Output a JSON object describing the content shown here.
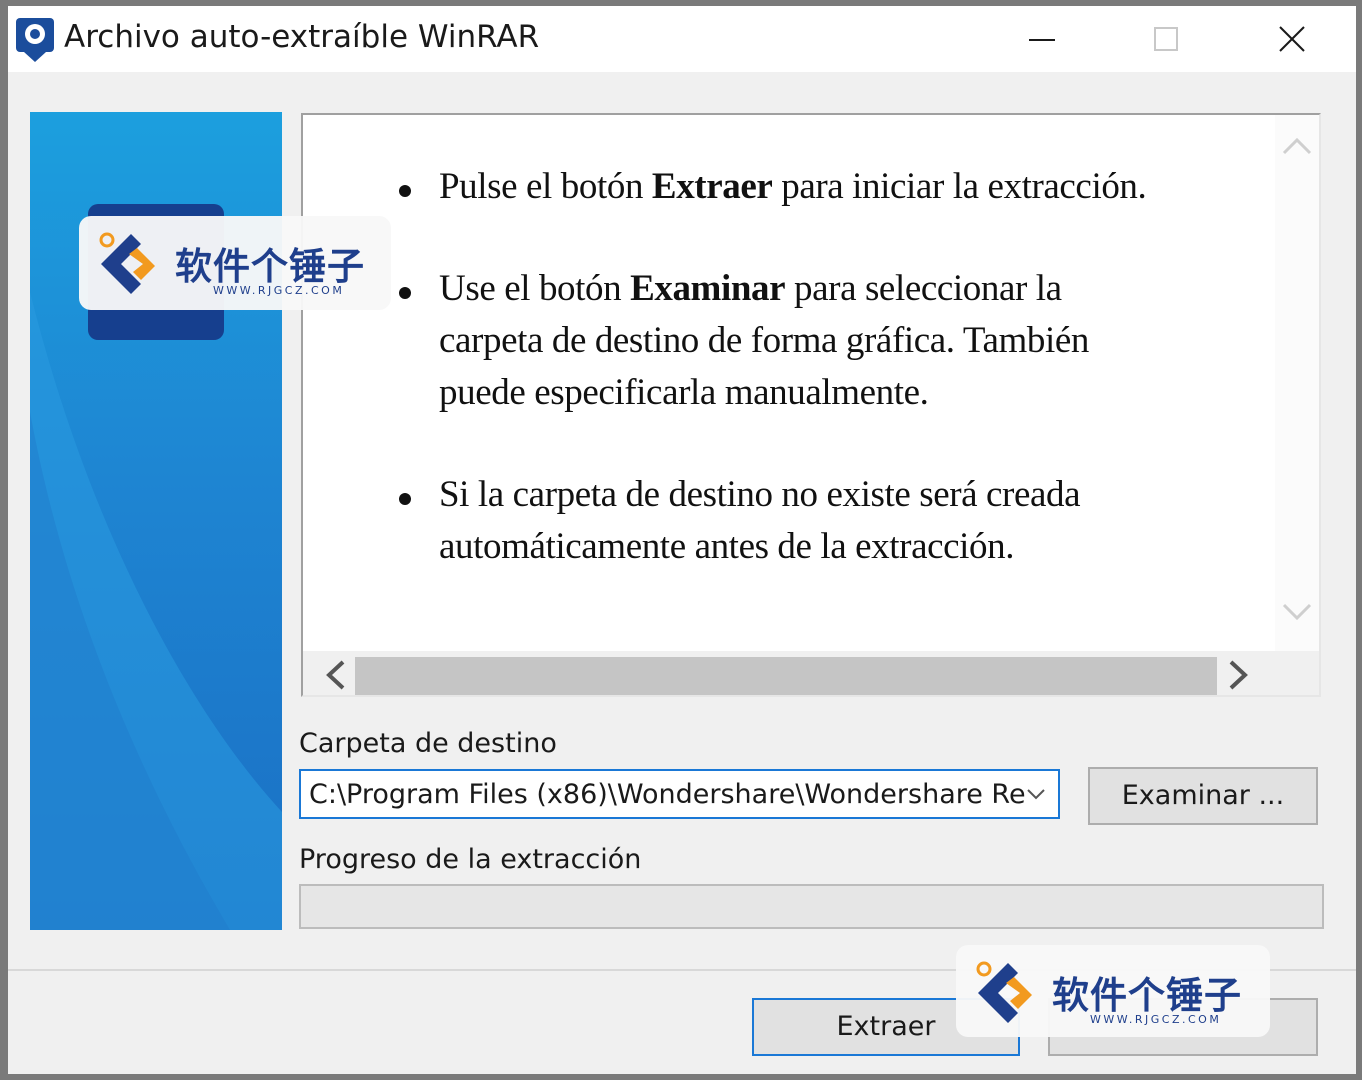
{
  "window": {
    "title": "Archivo auto-extraíble WinRAR"
  },
  "info": {
    "bullet1": {
      "pre": "Pulse el botón ",
      "bold": "Extraer",
      "post": " para iniciar la extracción."
    },
    "bullet2": {
      "pre": "Use el botón ",
      "bold": "Examinar",
      "post": " para seleccionar la",
      "line2": "carpeta de destino de forma gráfica. También",
      "line3": "puede especificarla manualmente."
    },
    "bullet3": {
      "line1": "Si la carpeta de destino no existe será creada",
      "line2": "automáticamente antes de la extracción."
    }
  },
  "destination": {
    "label": "Carpeta de destino",
    "value": "C:\\Program Files (x86)\\Wondershare\\Wondershare Re",
    "browse_label": "Examinar ..."
  },
  "progress": {
    "label": "Progreso de la extracción",
    "percent": 0
  },
  "footer": {
    "extract_label": "Extraer",
    "cancel_label": ""
  },
  "watermark": {
    "text": "软件个锤子",
    "url": "WWW.RJGCZ.COM"
  },
  "colors": {
    "accent": "#1a78d6",
    "side_panel": "#1e85d2",
    "watermark": "#1f3f8c"
  },
  "icons": {
    "app": "winrar-sfx-icon",
    "minimize": "minimize-icon",
    "maximize": "maximize-icon",
    "close": "close-icon",
    "scroll_up": "chevron-up-icon",
    "scroll_down": "chevron-down-icon",
    "scroll_left": "chevron-left-icon",
    "scroll_right": "chevron-right-icon",
    "dropdown": "chevron-down-icon"
  }
}
